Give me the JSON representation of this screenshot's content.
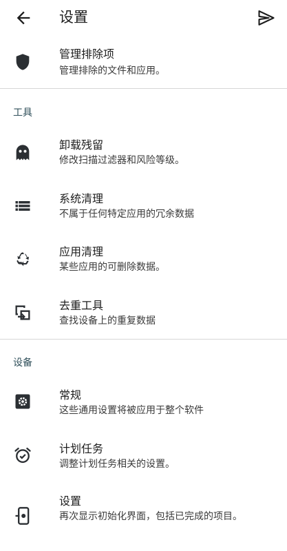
{
  "appbar": {
    "title": "设置",
    "back_icon": "arrow-back-icon",
    "send_icon": "send-icon"
  },
  "top": {
    "exclusions": {
      "title": "管理排除项",
      "subtitle": "管理排除的文件和应用。",
      "icon": "shield-icon"
    }
  },
  "sections": {
    "tools": {
      "header": "工具",
      "items": [
        {
          "title": "卸载残留",
          "subtitle": "修改扫描过滤器和风险等级。",
          "icon": "ghost-icon"
        },
        {
          "title": "系统清理",
          "subtitle": "不属于任何特定应用的冗余数据",
          "icon": "list-icon"
        },
        {
          "title": "应用清理",
          "subtitle": "某些应用的可删除数据。",
          "icon": "recycle-icon"
        },
        {
          "title": "去重工具",
          "subtitle": "查找设备上的重复数据",
          "icon": "duplicate-icon"
        }
      ]
    },
    "device": {
      "header": "设备",
      "items": [
        {
          "title": "常规",
          "subtitle": "这些通用设置将被应用于整个软件",
          "icon": "gear-box-icon"
        },
        {
          "title": "计划任务",
          "subtitle": "调整计划任务相关的设置。",
          "icon": "alarm-clock-icon"
        },
        {
          "title": "设置",
          "subtitle": "再次显示初始化界面，包括已完成的项目。",
          "icon": "setup-device-icon"
        }
      ]
    }
  }
}
